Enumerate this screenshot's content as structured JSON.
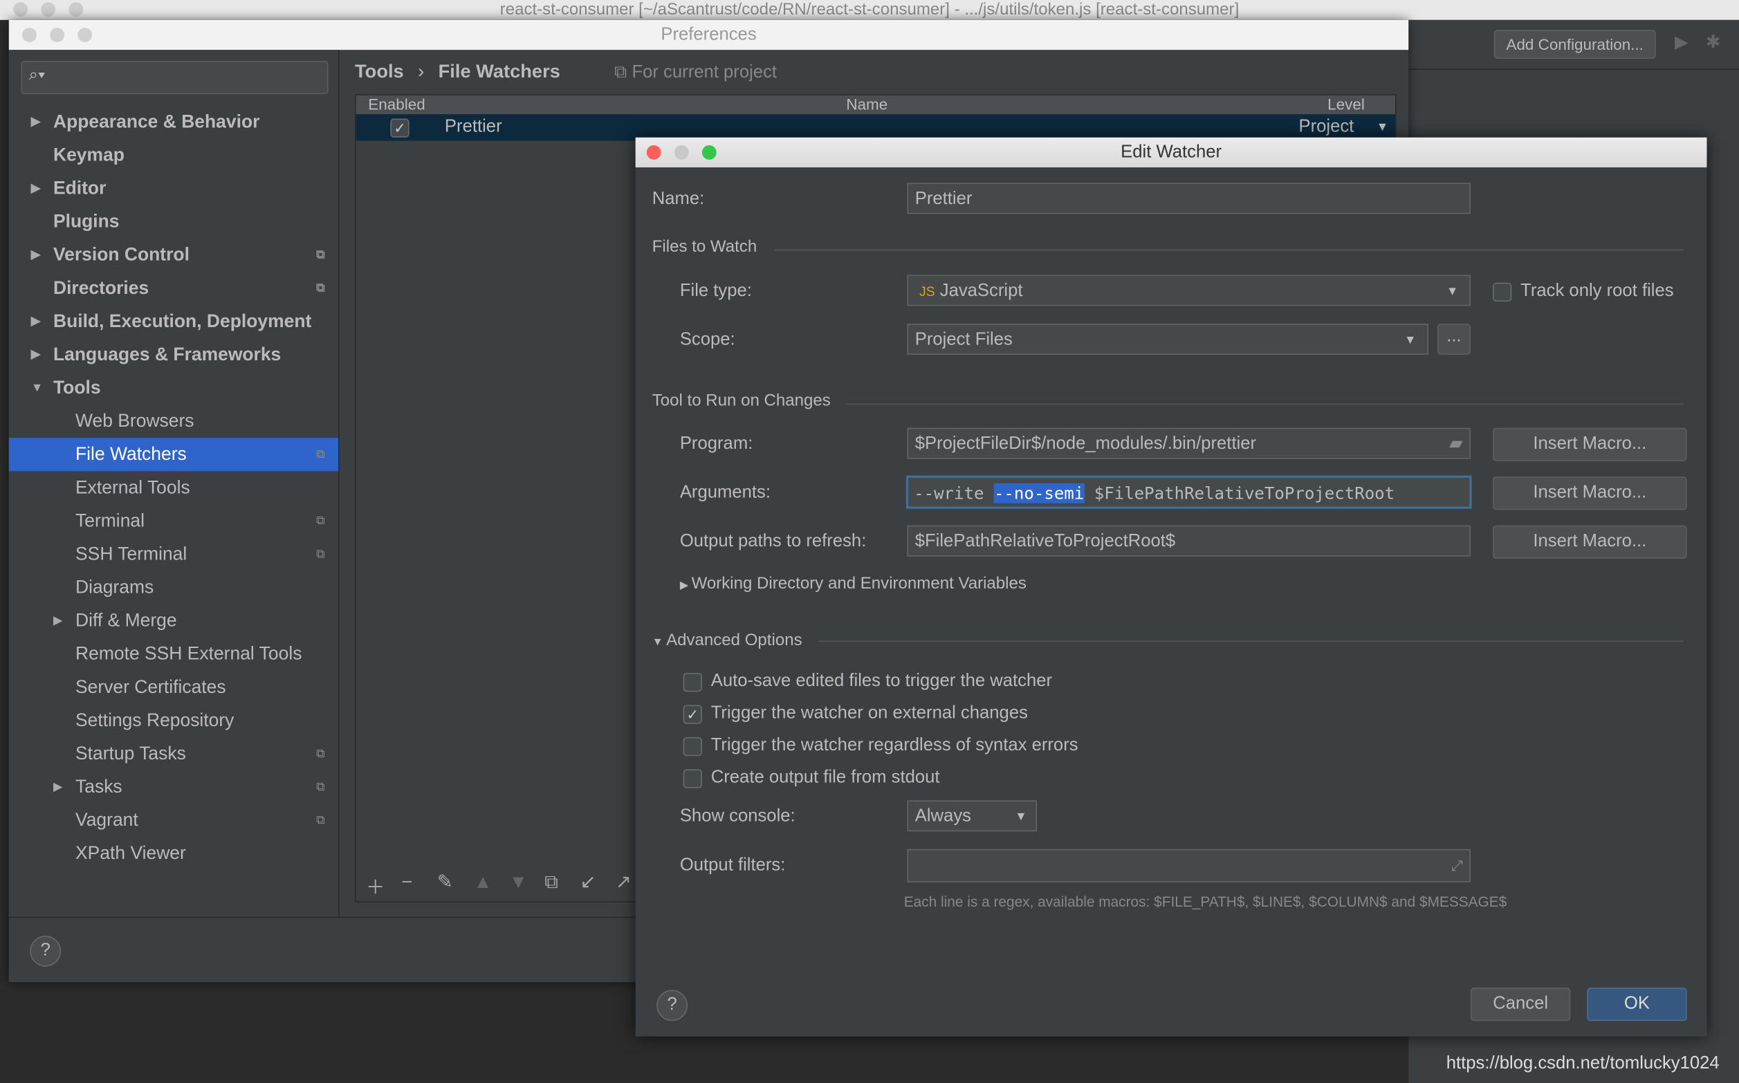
{
  "ide": {
    "title": "react-st-consumer [~/aScantrust/code/RN/react-st-consumer] - .../js/utils/token.js [react-st-consumer]",
    "add_configuration": "Add Configuration...",
    "watermark": "https://blog.csdn.net/tomlucky1024"
  },
  "preferences": {
    "title": "Preferences",
    "search": {
      "placeholder": "",
      "value": ""
    },
    "breadcrumb": {
      "parent": "Tools",
      "current": "File Watchers",
      "scope_note": "For current project"
    },
    "sidebar": {
      "items": [
        {
          "label": "Appearance & Behavior",
          "expandable": true,
          "bold": true
        },
        {
          "label": "Keymap",
          "bold": true
        },
        {
          "label": "Editor",
          "expandable": true,
          "bold": true
        },
        {
          "label": "Plugins",
          "bold": true
        },
        {
          "label": "Version Control",
          "expandable": true,
          "bold": true,
          "project": true
        },
        {
          "label": "Directories",
          "bold": true,
          "project": true
        },
        {
          "label": "Build, Execution, Deployment",
          "expandable": true,
          "bold": true
        },
        {
          "label": "Languages & Frameworks",
          "expandable": true,
          "bold": true
        },
        {
          "label": "Tools",
          "expanded": true,
          "bold": true
        },
        {
          "label": "Web Browsers",
          "child": true
        },
        {
          "label": "File Watchers",
          "child": true,
          "selected": true,
          "project": true
        },
        {
          "label": "External Tools",
          "child": true
        },
        {
          "label": "Terminal",
          "child": true,
          "project": true
        },
        {
          "label": "SSH Terminal",
          "child": true,
          "project": true
        },
        {
          "label": "Diagrams",
          "child": true
        },
        {
          "label": "Diff & Merge",
          "child": true,
          "expandable": true
        },
        {
          "label": "Remote SSH External Tools",
          "child": true
        },
        {
          "label": "Server Certificates",
          "child": true
        },
        {
          "label": "Settings Repository",
          "child": true
        },
        {
          "label": "Startup Tasks",
          "child": true,
          "project": true
        },
        {
          "label": "Tasks",
          "child": true,
          "expandable": true,
          "project": true
        },
        {
          "label": "Vagrant",
          "child": true,
          "project": true
        },
        {
          "label": "XPath Viewer",
          "child": true
        }
      ]
    },
    "table": {
      "columns": [
        "Enabled",
        "Name",
        "Level"
      ],
      "rows": [
        {
          "enabled": true,
          "name": "Prettier",
          "level": "Project"
        }
      ]
    },
    "toolbar_icons": [
      "add-icon",
      "remove-icon",
      "edit-icon",
      "move-up-icon",
      "move-down-icon",
      "copy-icon",
      "import-icon",
      "export-icon"
    ],
    "help": "?"
  },
  "dialog": {
    "title": "Edit Watcher",
    "name_label": "Name:",
    "name_value": "Prettier",
    "files_to_watch": "Files to Watch",
    "file_type_label": "File type:",
    "file_type_value": "JavaScript",
    "track_root_label": "Track only root files",
    "track_root_checked": false,
    "scope_label": "Scope:",
    "scope_value": "Project Files",
    "scope_more": "...",
    "tool_section": "Tool to Run on Changes",
    "program_label": "Program:",
    "program_value": "$ProjectFileDir$/node_modules/.bin/prettier",
    "arguments_label": "Arguments:",
    "arguments_pre": "--write ",
    "arguments_selected": "--no-semi",
    "arguments_post": " $FilePathRelativeToProjectRoot",
    "output_label": "Output paths to refresh:",
    "output_value": "$FilePathRelativeToProjectRoot$",
    "insert_macro": "Insert Macro...",
    "working_dir": "Working Directory and Environment Variables",
    "advanced": "Advanced Options",
    "options": [
      {
        "label": "Auto-save edited files to trigger the watcher",
        "checked": false
      },
      {
        "label": "Trigger the watcher on external changes",
        "checked": true
      },
      {
        "label": "Trigger the watcher regardless of syntax errors",
        "checked": false
      },
      {
        "label": "Create output file from stdout",
        "checked": false
      }
    ],
    "show_console_label": "Show console:",
    "show_console_value": "Always",
    "output_filters_label": "Output filters:",
    "output_filters_value": "",
    "hint": "Each line is a regex, available macros: $FILE_PATH$, $LINE$, $COLUMN$ and $MESSAGE$",
    "cancel": "Cancel",
    "ok": "OK",
    "help": "?",
    "accent": "#365880",
    "selection": "#2f65ca"
  }
}
